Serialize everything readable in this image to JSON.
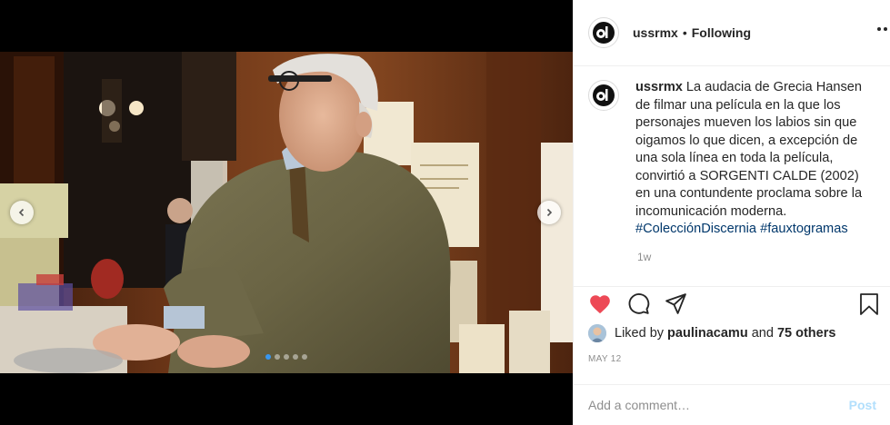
{
  "post": {
    "username": "ussrmx",
    "follow_status": "Following",
    "separator": "•"
  },
  "caption": {
    "username": "ussrmx",
    "text": "La audacia de Grecia Hansen de filmar una película en la que los personajes mueven los labios sin que oigamos lo que dicen, a excepción de una sola línea en toda la película, convirtió a SORGENTI CALDE (2002) en una contundente proclama sobre la incomunicación moderna.",
    "hashtags": [
      "#ColecciónDiscernia",
      "#fauxtogramas"
    ],
    "time_ago": "1w"
  },
  "likes": {
    "prefix": "Liked by ",
    "user": "paulinacamu",
    "middle": " and ",
    "others": "75 others"
  },
  "date": "MAY 12",
  "comment_box": {
    "placeholder": "Add a comment…",
    "post_label": "Post"
  },
  "carousel": {
    "slides": 5,
    "active_slide": 1
  },
  "colors": {
    "like_red": "#ed4956",
    "hashtag": "#00376b",
    "dot_active": "#3897f0",
    "post_disabled": "#b2dffc"
  },
  "icons": {
    "like": "heart-icon",
    "comment": "comment-icon",
    "share": "share-icon",
    "save": "bookmark-icon",
    "more": "more-options-icon",
    "prev": "chevron-left-icon",
    "next": "chevron-right-icon"
  }
}
